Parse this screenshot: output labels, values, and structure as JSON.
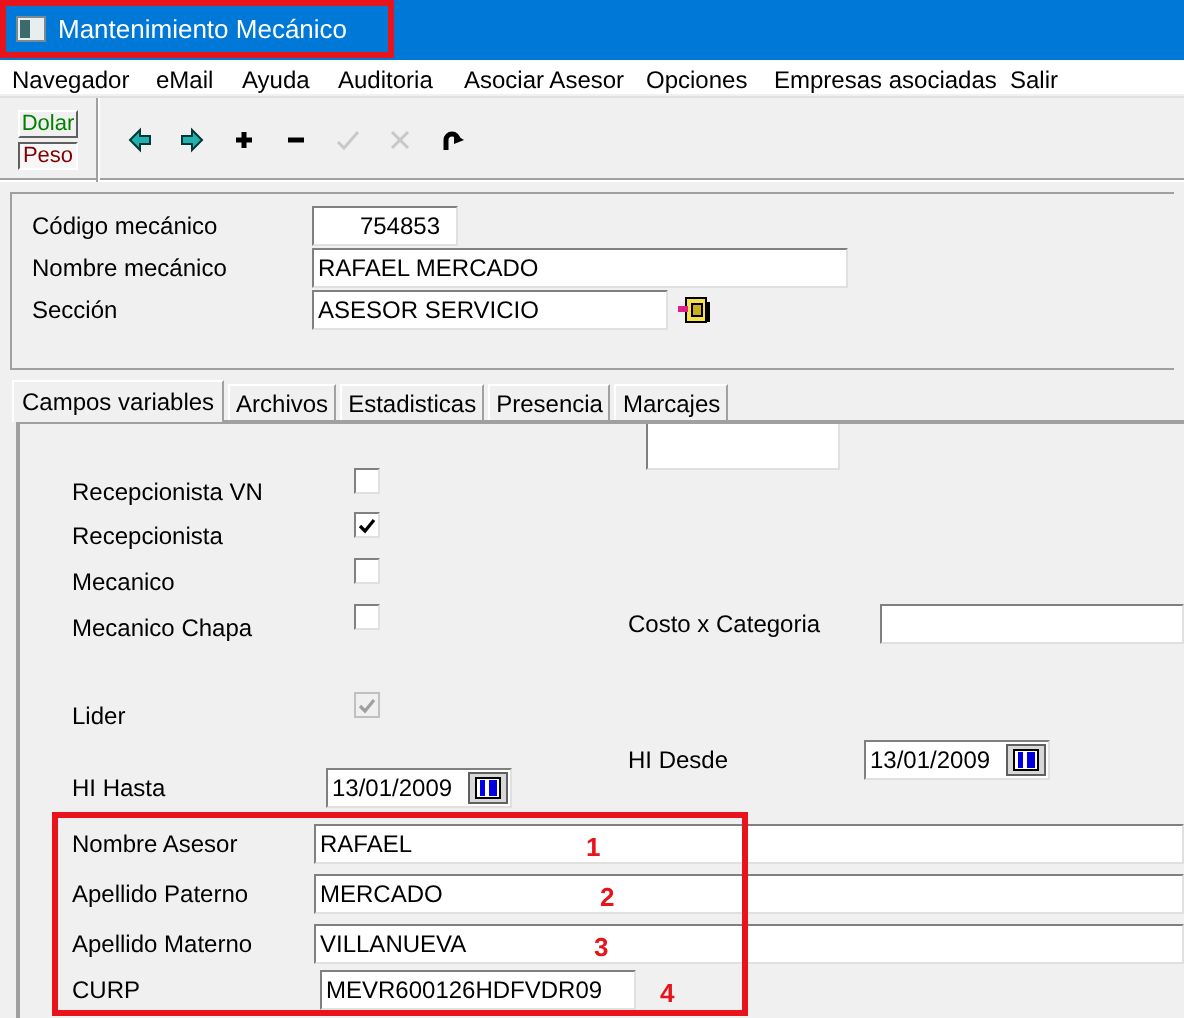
{
  "window": {
    "title": "Mantenimiento Mecánico"
  },
  "menu": [
    "Navegador",
    "eMail",
    "Ayuda",
    "Auditoria",
    "Asociar Asesor",
    "Opciones",
    "Empresas asociadas",
    "Salir"
  ],
  "currency": [
    {
      "label": "Dolar",
      "selected": false
    },
    {
      "label": "Peso",
      "selected": true
    }
  ],
  "toolbar": [
    {
      "kind": "back",
      "disabled": false
    },
    {
      "kind": "forward",
      "disabled": false
    },
    {
      "kind": "add",
      "disabled": false
    },
    {
      "kind": "remove",
      "disabled": false
    },
    {
      "kind": "confirm",
      "disabled": true
    },
    {
      "kind": "cancel",
      "disabled": true
    },
    {
      "kind": "refresh",
      "disabled": false
    }
  ],
  "header": [
    {
      "label": "Código mecánico",
      "value": "754853"
    },
    {
      "label": "Nombre mecánico",
      "value": "RAFAEL MERCADO"
    },
    {
      "label": "Sección",
      "value": "ASESOR SERVICIO"
    }
  ],
  "tabs": [
    {
      "label": "Campos variables",
      "selected": true
    },
    {
      "label": "Archivos",
      "selected": false
    },
    {
      "label": "Estadisticas",
      "selected": false
    },
    {
      "label": "Presencia",
      "selected": false
    },
    {
      "label": "Marcajes",
      "selected": false
    }
  ],
  "fields": [
    {
      "kind": "text"
    },
    {
      "kind": "checkbox",
      "label": "Recepcionista VN",
      "checked": false,
      "disabled": false
    },
    {
      "kind": "checkbox",
      "label": "Recepcionista",
      "checked": true,
      "disabled": false
    },
    {
      "kind": "checkbox",
      "label": "Mecanico",
      "checked": false,
      "disabled": false
    },
    {
      "kind": "checkbox",
      "label": "Mecanico Chapa",
      "checked": false,
      "disabled": false
    },
    {
      "kind": "text",
      "label": "Costo x Categoria"
    },
    {
      "kind": "checkbox",
      "label": "Lider",
      "checked": true,
      "disabled": true
    },
    {
      "kind": "date",
      "label": "HI Desde",
      "value": "13/01/2009"
    },
    {
      "kind": "date",
      "label": "HI Hasta",
      "value": "13/01/2009"
    },
    {
      "kind": "text",
      "label": "Nombre Asesor",
      "value": "RAFAEL",
      "note": "1"
    },
    {
      "kind": "text",
      "label": "Apellido Paterno",
      "value": "MERCADO",
      "note": "2"
    },
    {
      "kind": "text",
      "label": "Apellido Materno",
      "value": "VILLANUEVA",
      "note": "3"
    },
    {
      "kind": "text",
      "label": "CURP",
      "value": "MEVR600126HDFVDR09",
      "note": "4"
    }
  ]
}
